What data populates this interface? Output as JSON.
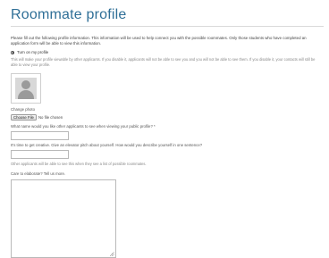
{
  "page": {
    "title": "Roommate profile",
    "intro": "Please fill out the following profile information. This information will be used to help connect you with the possible roommates. Only those students who have completed an application form will be able to view this information.",
    "visibility_toggle_label": "Turn on my profile",
    "visibility_hint": "This will make your profile viewable by other applicants. If you disable it, applicants will not be able to see you and you will not be able to see them. If you disable it, your contacts will still be able to view your profile."
  },
  "photo": {
    "change_label": "Change photo",
    "file_button_label": "Choose File",
    "file_status": "No file chosen"
  },
  "form": {
    "public_name_label": "What name would you like other applicants to see when viewing your public profile? *",
    "public_name_value": "",
    "pitch_label": "It's time to get creative. Give an elevator pitch about yourself. How would you describe yourself in one sentence?",
    "pitch_value": "",
    "pitch_hint": "Other applicants will be able to see this when they see a list of possible roommates.",
    "elaborate_label": "Care to elaborate? Tell us more.",
    "elaborate_value": ""
  }
}
